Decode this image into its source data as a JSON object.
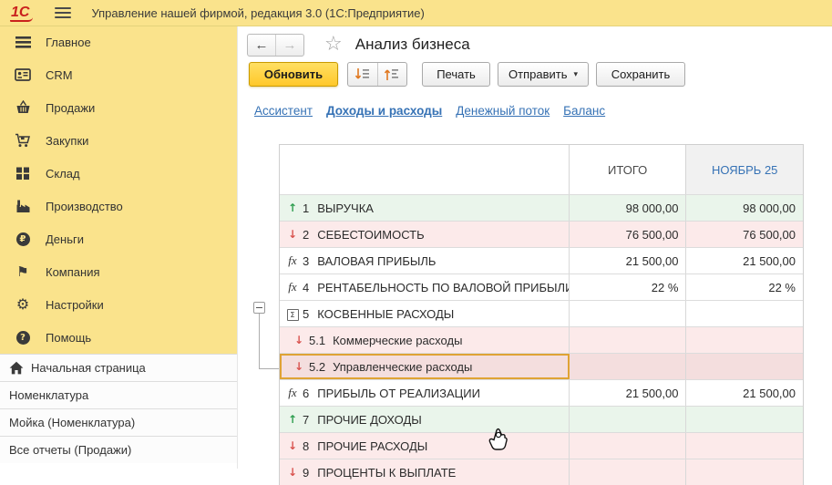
{
  "topbar": {
    "logo_text": "1С",
    "app_title": "Управление нашей фирмой, редакция 3.0  (1С:Предприятие)"
  },
  "sidebar": {
    "items": [
      {
        "icon": "menu-lines-icon",
        "label": "Главное"
      },
      {
        "icon": "crm-card-icon",
        "label": "CRM"
      },
      {
        "icon": "basket-icon",
        "label": "Продажи"
      },
      {
        "icon": "cart-icon",
        "label": "Закупки"
      },
      {
        "icon": "boxes-icon",
        "label": "Склад"
      },
      {
        "icon": "factory-icon",
        "label": "Производство"
      },
      {
        "icon": "ruble-circle-icon",
        "label": "Деньги"
      },
      {
        "icon": "flag-icon",
        "label": "Компания"
      },
      {
        "icon": "gear-icon",
        "label": "Настройки"
      },
      {
        "icon": "question-circle-icon",
        "label": "Помощь"
      }
    ],
    "bottom_items": [
      {
        "icon": "home-icon",
        "label": "Начальная страница"
      },
      {
        "icon": "",
        "label": "Номенклатура"
      },
      {
        "icon": "",
        "label": "Мойка (Номенклатура)"
      },
      {
        "icon": "",
        "label": "Все отчеты (Продажи)"
      }
    ]
  },
  "main": {
    "page_title": "Анализ бизнеса",
    "toolbar": {
      "refresh_label": "Обновить",
      "print_label": "Печать",
      "send_label": "Отправить",
      "save_label": "Сохранить",
      "expand_icon": "expand-all-icon",
      "collapse_icon": "collapse-all-icon"
    },
    "tabs": [
      {
        "label": "Ассистент",
        "active": false
      },
      {
        "label": "Доходы и расходы",
        "active": true
      },
      {
        "label": "Денежный поток",
        "active": false
      },
      {
        "label": "Баланс",
        "active": false
      }
    ],
    "table": {
      "columns": [
        {
          "label": ""
        },
        {
          "label": "ИТОГО"
        },
        {
          "label": "НОЯБРЬ 25",
          "highlight": true
        }
      ],
      "rows": [
        {
          "num": "1",
          "label": "ВЫРУЧКА",
          "marker": "up",
          "tone": "green",
          "itogo": "98 000,00",
          "period": "98 000,00"
        },
        {
          "num": "2",
          "label": "СЕБЕСТОИМОСТЬ",
          "marker": "down",
          "tone": "red",
          "itogo": "76 500,00",
          "period": "76 500,00"
        },
        {
          "num": "3",
          "label": "ВАЛОВАЯ ПРИБЫЛЬ",
          "marker": "fx",
          "tone": "white",
          "itogo": "21 500,00",
          "period": "21 500,00"
        },
        {
          "num": "4",
          "label": "РЕНТАБЕЛЬНОСТЬ ПО ВАЛОВОЙ ПРИБЫЛИ",
          "marker": "fx",
          "tone": "white",
          "itogo": "22 %",
          "period": "22 %"
        },
        {
          "num": "5",
          "label": "КОСВЕННЫЕ РАСХОДЫ",
          "marker": "group",
          "tone": "white",
          "itogo": "",
          "period": "",
          "expandable": true
        },
        {
          "num": "5.1",
          "label": "Коммерческие расходы",
          "marker": "down",
          "tone": "red",
          "itogo": "",
          "period": "",
          "child": true
        },
        {
          "num": "5.2",
          "label": "Управленческие расходы",
          "marker": "down",
          "tone": "red",
          "itogo": "",
          "period": "",
          "child": true,
          "selected": true
        },
        {
          "num": "6",
          "label": "ПРИБЫЛЬ ОТ РЕАЛИЗАЦИИ",
          "marker": "fx",
          "tone": "white",
          "itogo": "21 500,00",
          "period": "21 500,00"
        },
        {
          "num": "7",
          "label": "ПРОЧИЕ ДОХОДЫ",
          "marker": "up",
          "tone": "green",
          "itogo": "",
          "period": ""
        },
        {
          "num": "8",
          "label": "ПРОЧИЕ РАСХОДЫ",
          "marker": "down",
          "tone": "red",
          "itogo": "",
          "period": ""
        },
        {
          "num": "9",
          "label": "ПРОЦЕНТЫ К ВЫПЛАТЕ",
          "marker": "down",
          "tone": "red",
          "itogo": "",
          "period": ""
        }
      ]
    }
  },
  "icons": {
    "back": "←",
    "forward": "→",
    "favorite": "☆",
    "dropdown": "▾",
    "gear": "⚙",
    "flag": "⚑",
    "ruble": "₽",
    "question": "?",
    "up": "↑",
    "down": "↓",
    "fx": "fx",
    "sigma": "Σ"
  },
  "colors": {
    "topbar_bg": "#FAE38C",
    "accent_yellow": "#FFC829",
    "link_blue": "#3672B5",
    "up_green": "#2E9E4F",
    "down_red": "#D9534F",
    "row_green": "#EAF5EB",
    "row_red": "#FCEAEA",
    "selection_orange": "#DFA335",
    "logo_red": "#C9201D"
  }
}
